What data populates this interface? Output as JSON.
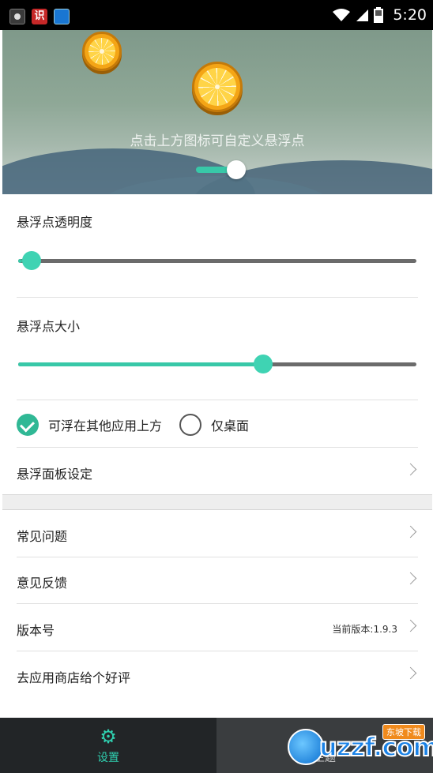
{
  "status_bar": {
    "time": "5:20",
    "left_icons": [
      "app-icon",
      "translate-app-icon",
      "browser-app-icon"
    ],
    "right_icons": [
      "wifi-icon",
      "signal-icon",
      "battery-icon"
    ]
  },
  "banner": {
    "hint": "点击上方图标可自定义悬浮点",
    "toggle_on": true
  },
  "settings": {
    "opacity_label": "悬浮点透明度",
    "opacity_value": 0.01,
    "size_label": "悬浮点大小",
    "size_value": 0.62,
    "mode_options": [
      {
        "label": "可浮在其他应用上方",
        "selected": true
      },
      {
        "label": "仅桌面",
        "selected": false
      }
    ],
    "panel_settings_label": "悬浮面板设定"
  },
  "menu": {
    "faq": "常见问题",
    "feedback": "意见反馈",
    "version_label": "版本号",
    "version_value": "当前版本:1.9.3",
    "rate": "去应用商店给个好评"
  },
  "tabs": [
    {
      "label": "设置",
      "icon": "gear-icon",
      "active": true
    },
    {
      "label": "主题",
      "icon": "theme-icon",
      "active": false
    }
  ],
  "watermark": {
    "text": "uzzf.com",
    "badge": "东坡下载"
  },
  "colors": {
    "accent": "#38c8a8",
    "tab_bar": "#222527"
  }
}
